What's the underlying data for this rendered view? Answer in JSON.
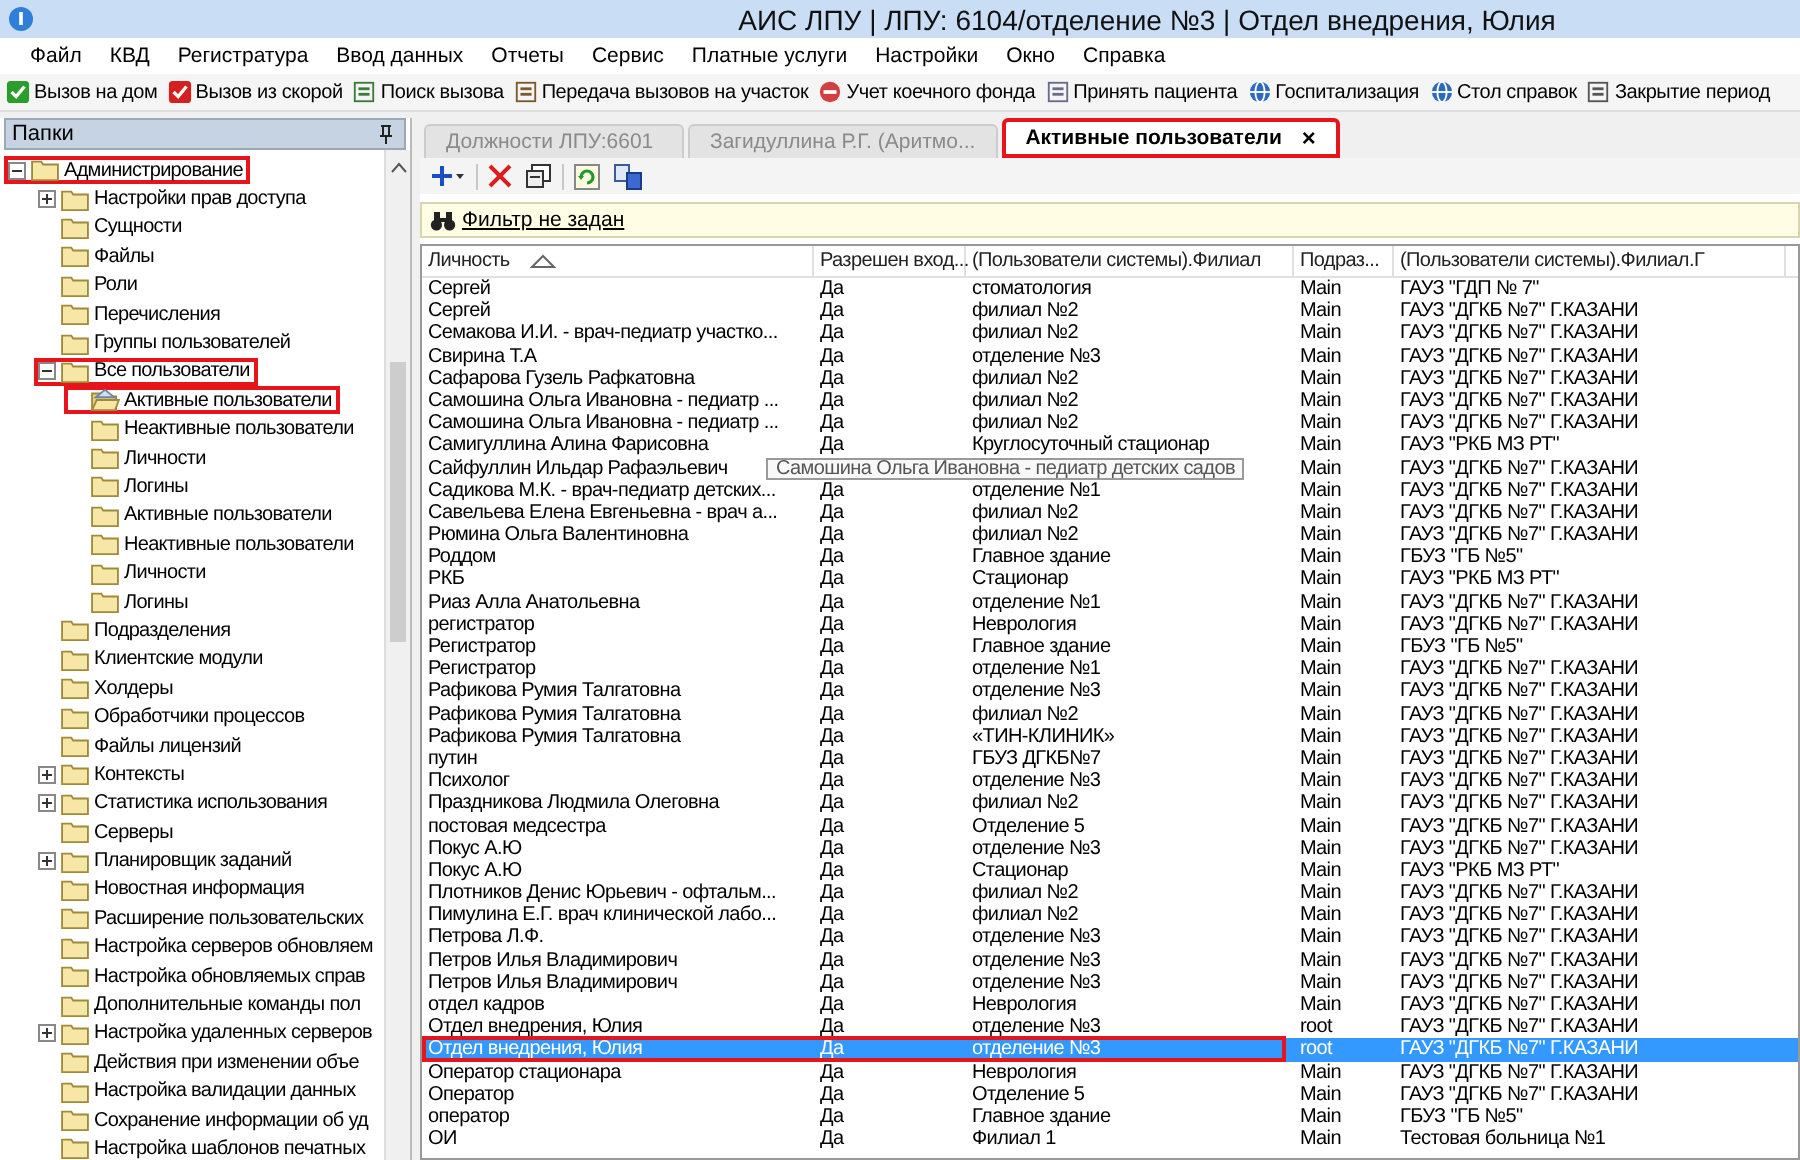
{
  "window": {
    "title": "АИС ЛПУ | ЛПУ: 6104/отделение №3 | Отдел внедрения, Юлия"
  },
  "menu": [
    "Файл",
    "КВД",
    "Регистратура",
    "Ввод данных",
    "Отчеты",
    "Сервис",
    "Платные услуги",
    "Настройки",
    "Окно",
    "Справка"
  ],
  "toolbar": [
    "Вызов на дом",
    "Вызов из скорой",
    "Поиск вызова",
    "Передача вызовов на участок",
    "Учет коечного фонда",
    "Принять пациента",
    "Госпитализация",
    "Стол справок",
    "Закрытие период"
  ],
  "folders_panel": {
    "title": "Папки",
    "tree": [
      {
        "label": "Администрирование",
        "expanded": true,
        "selected": false,
        "highlighted": true,
        "children": [
          {
            "label": "Настройки прав доступа",
            "expanded": false,
            "selected": false,
            "highlighted": false
          },
          {
            "label": "Сущности",
            "selected": false,
            "highlighted": false
          },
          {
            "label": "Файлы",
            "selected": false,
            "highlighted": false
          },
          {
            "label": "Роли",
            "selected": false,
            "highlighted": false
          },
          {
            "label": "Перечисления",
            "selected": false,
            "highlighted": false
          },
          {
            "label": "Группы пользователей",
            "selected": false,
            "highlighted": false
          },
          {
            "label": "Все пользователи",
            "expanded": true,
            "selected": false,
            "highlighted": true,
            "children": [
              {
                "label": "Активные пользователи",
                "selected": true,
                "highlighted": true
              },
              {
                "label": "Неактивные пользователи",
                "selected": false,
                "highlighted": false
              },
              {
                "label": "Личности",
                "selected": false,
                "highlighted": false
              },
              {
                "label": "Логины",
                "selected": false,
                "highlighted": false
              },
              {
                "label": "Активные пользователи",
                "selected": false,
                "highlighted": false
              },
              {
                "label": "Неактивные пользователи",
                "selected": false,
                "highlighted": false
              },
              {
                "label": "Личности",
                "selected": false,
                "highlighted": false
              },
              {
                "label": "Логины",
                "selected": false,
                "highlighted": false
              }
            ]
          },
          {
            "label": "Подразделения",
            "selected": false,
            "highlighted": false
          },
          {
            "label": "Клиентские модули",
            "selected": false,
            "highlighted": false
          },
          {
            "label": "Холдеры",
            "selected": false,
            "highlighted": false
          },
          {
            "label": "Обработчики процессов",
            "selected": false,
            "highlighted": false
          },
          {
            "label": "Файлы лицензий",
            "selected": false,
            "highlighted": false
          },
          {
            "label": "Контексты",
            "expanded": false,
            "selected": false,
            "highlighted": false
          },
          {
            "label": "Статистика использования",
            "expanded": false,
            "selected": false,
            "highlighted": false
          },
          {
            "label": "Серверы",
            "selected": false,
            "highlighted": false
          },
          {
            "label": "Планировщик заданий",
            "expanded": false,
            "selected": false,
            "highlighted": false
          },
          {
            "label": "Новостная информация",
            "selected": false,
            "highlighted": false
          },
          {
            "label": "Расширение пользовательских",
            "selected": false,
            "highlighted": false
          },
          {
            "label": "Настройка серверов обновляем",
            "selected": false,
            "highlighted": false
          },
          {
            "label": "Настройка обновляемых справ",
            "selected": false,
            "highlighted": false
          },
          {
            "label": "Дополнительные команды пол",
            "selected": false,
            "highlighted": false
          },
          {
            "label": "Настройка удаленных серверов",
            "expanded": false,
            "selected": false,
            "highlighted": false
          },
          {
            "label": "Действия при изменении объе",
            "selected": false,
            "highlighted": false
          },
          {
            "label": "Настройка валидации данных",
            "selected": false,
            "highlighted": false
          },
          {
            "label": "Сохранение информации об уд",
            "selected": false,
            "highlighted": false
          },
          {
            "label": "Настройка шаблонов печатных",
            "selected": false,
            "highlighted": false
          }
        ]
      }
    ]
  },
  "tabs": [
    {
      "label": "Должности ЛПУ:6601",
      "selected": false,
      "highlighted": false
    },
    {
      "label": "Загидуллина  Р.Г.  (Аритмо...",
      "selected": false,
      "highlighted": false
    },
    {
      "label": "Активные пользователи",
      "selected": true,
      "highlighted": true,
      "close": "×"
    }
  ],
  "filter": {
    "link": "Фильтр не задан"
  },
  "table": {
    "columns": [
      {
        "label": "Личность",
        "sorted": true
      },
      {
        "label": "Разрешен вход..."
      },
      {
        "label": "(Пользователи системы).Филиал"
      },
      {
        "label": "Подраз..."
      },
      {
        "label": "(Пользователи системы).Филиал.Г"
      }
    ],
    "rows": [
      {
        "cells": [
          "Сергей",
          "Да",
          "стоматология",
          "Main",
          "ГАУЗ \"ГДП № 7\""
        ],
        "selected": false,
        "highlighted": false
      },
      {
        "cells": [
          "Сергей",
          "Да",
          "филиал №2",
          "Main",
          "ГАУЗ \"ДГКБ №7\" Г.КАЗАНИ"
        ],
        "selected": false,
        "highlighted": false
      },
      {
        "cells": [
          "Семакова И.И. - врач-педиатр участко...",
          "Да",
          "филиал №2",
          "Main",
          "ГАУЗ \"ДГКБ №7\" Г.КАЗАНИ"
        ],
        "selected": false,
        "highlighted": false
      },
      {
        "cells": [
          "Свирина Т.А",
          "Да",
          "отделение №3",
          "Main",
          "ГАУЗ \"ДГКБ №7\" Г.КАЗАНИ"
        ],
        "selected": false,
        "highlighted": false
      },
      {
        "cells": [
          "Сафарова Гузель Рафкатовна",
          "Да",
          "филиал №2",
          "Main",
          "ГАУЗ \"ДГКБ №7\" Г.КАЗАНИ"
        ],
        "selected": false,
        "highlighted": false
      },
      {
        "cells": [
          "Самошина Ольга Ивановна - педиатр ...",
          "Да",
          "филиал №2",
          "Main",
          "ГАУЗ \"ДГКБ №7\" Г.КАЗАНИ"
        ],
        "selected": false,
        "highlighted": false
      },
      {
        "cells": [
          "Самошина Ольга Ивановна - педиатр ...",
          "Да",
          "филиал №2",
          "Main",
          "ГАУЗ \"ДГКБ №7\" Г.КАЗАНИ"
        ],
        "selected": false,
        "highlighted": false
      },
      {
        "cells": [
          "Самигуллина Алина Фарисовна",
          "Да",
          "Круглосуточный стационар",
          "Main",
          "ГАУЗ \"РКБ МЗ РТ\""
        ],
        "selected": false,
        "highlighted": false
      },
      {
        "cells": [
          "Сайфуллин Ильдар Рафаэльевич",
          null,
          null,
          "Main",
          "ГАУЗ \"ДГКБ №7\" Г.КАЗАНИ"
        ],
        "selected": false,
        "highlighted": false,
        "tooltip": "Самошина Ольга Ивановна - педиатр детских садов"
      },
      {
        "cells": [
          "Садикова М.К. - врач-педиатр детских...",
          "Да",
          "отделение №1",
          "Main",
          "ГАУЗ \"ДГКБ №7\" Г.КАЗАНИ"
        ],
        "selected": false,
        "highlighted": false
      },
      {
        "cells": [
          "Савельева Елена Евгеньевна - врач а...",
          "Да",
          "филиал №2",
          "Main",
          "ГАУЗ \"ДГКБ №7\" Г.КАЗАНИ"
        ],
        "selected": false,
        "highlighted": false
      },
      {
        "cells": [
          "Рюмина Ольга Валентиновна",
          "Да",
          "филиал №2",
          "Main",
          "ГАУЗ \"ДГКБ №7\" Г.КАЗАНИ"
        ],
        "selected": false,
        "highlighted": false
      },
      {
        "cells": [
          "Роддом",
          "Да",
          "Главное здание",
          "Main",
          "ГБУЗ \"ГБ №5\""
        ],
        "selected": false,
        "highlighted": false
      },
      {
        "cells": [
          "РКБ",
          "Да",
          "Стационар",
          "Main",
          "ГАУЗ \"РКБ МЗ РТ\""
        ],
        "selected": false,
        "highlighted": false
      },
      {
        "cells": [
          "Риаз Алла Анатольевна",
          "Да",
          "отделение №1",
          "Main",
          "ГАУЗ \"ДГКБ №7\" Г.КАЗАНИ"
        ],
        "selected": false,
        "highlighted": false
      },
      {
        "cells": [
          "регистратор",
          "Да",
          "Неврология",
          "Main",
          "ГАУЗ \"ДГКБ №7\" Г.КАЗАНИ"
        ],
        "selected": false,
        "highlighted": false
      },
      {
        "cells": [
          "Регистратор",
          "Да",
          "Главное здание",
          "Main",
          "ГБУЗ \"ГБ №5\""
        ],
        "selected": false,
        "highlighted": false
      },
      {
        "cells": [
          "Регистратор",
          "Да",
          "отделение №1",
          "Main",
          "ГАУЗ \"ДГКБ №7\" Г.КАЗАНИ"
        ],
        "selected": false,
        "highlighted": false
      },
      {
        "cells": [
          "Рафикова Румия Талгатовна",
          "Да",
          "отделение №3",
          "Main",
          "ГАУЗ \"ДГКБ №7\" Г.КАЗАНИ"
        ],
        "selected": false,
        "highlighted": false
      },
      {
        "cells": [
          "Рафикова Румия Талгатовна",
          "Да",
          "филиал №2",
          "Main",
          "ГАУЗ \"ДГКБ №7\" Г.КАЗАНИ"
        ],
        "selected": false,
        "highlighted": false
      },
      {
        "cells": [
          "Рафикова Румия Талгатовна",
          "Да",
          "«ТИН-КЛИНИК»",
          "Main",
          "ГАУЗ \"ДГКБ №7\" Г.КАЗАНИ"
        ],
        "selected": false,
        "highlighted": false
      },
      {
        "cells": [
          "путин",
          "Да",
          "ГБУЗ ДГКБ№7",
          "Main",
          "ГАУЗ \"ДГКБ №7\" Г.КАЗАНИ"
        ],
        "selected": false,
        "highlighted": false
      },
      {
        "cells": [
          "Психолог",
          "Да",
          "отделение №3",
          "Main",
          "ГАУЗ \"ДГКБ №7\" Г.КАЗАНИ"
        ],
        "selected": false,
        "highlighted": false
      },
      {
        "cells": [
          "Праздникова Людмила Олеговна",
          "Да",
          "филиал №2",
          "Main",
          "ГАУЗ \"ДГКБ №7\" Г.КАЗАНИ"
        ],
        "selected": false,
        "highlighted": false
      },
      {
        "cells": [
          "постовая медсестра",
          "Да",
          "Отделение 5",
          "Main",
          "ГАУЗ \"ДГКБ №7\" Г.КАЗАНИ"
        ],
        "selected": false,
        "highlighted": false
      },
      {
        "cells": [
          "Покус А.Ю",
          "Да",
          "отделение №3",
          "Main",
          "ГАУЗ \"ДГКБ №7\" Г.КАЗАНИ"
        ],
        "selected": false,
        "highlighted": false
      },
      {
        "cells": [
          "Покус А.Ю",
          "Да",
          "Стационар",
          "Main",
          "ГАУЗ \"РКБ МЗ РТ\""
        ],
        "selected": false,
        "highlighted": false
      },
      {
        "cells": [
          "Плотников Денис Юрьевич - офтальм...",
          "Да",
          "филиал №2",
          "Main",
          "ГАУЗ \"ДГКБ №7\" Г.КАЗАНИ"
        ],
        "selected": false,
        "highlighted": false
      },
      {
        "cells": [
          "Пимулина Е.Г. врач клинической лабо...",
          "Да",
          "филиал №2",
          "Main",
          "ГАУЗ \"ДГКБ №7\" Г.КАЗАНИ"
        ],
        "selected": false,
        "highlighted": false
      },
      {
        "cells": [
          "Петрова Л.Ф.",
          "Да",
          "отделение №3",
          "Main",
          "ГАУЗ \"ДГКБ №7\" Г.КАЗАНИ"
        ],
        "selected": false,
        "highlighted": false
      },
      {
        "cells": [
          "Петров Илья Владимирович",
          "Да",
          "отделение №3",
          "Main",
          "ГАУЗ \"ДГКБ №7\" Г.КАЗАНИ"
        ],
        "selected": false,
        "highlighted": false
      },
      {
        "cells": [
          "Петров Илья Владимирович",
          "Да",
          "отделение №3",
          "Main",
          "ГАУЗ \"ДГКБ №7\" Г.КАЗАНИ"
        ],
        "selected": false,
        "highlighted": false
      },
      {
        "cells": [
          "отдел кадров",
          "Да",
          "Неврология",
          "Main",
          "ГАУЗ \"ДГКБ №7\" Г.КАЗАНИ"
        ],
        "selected": false,
        "highlighted": false
      },
      {
        "cells": [
          "Отдел внедрения, Юлия",
          "Да",
          "отделение №3",
          "root",
          "ГАУЗ \"ДГКБ №7\" Г.КАЗАНИ"
        ],
        "selected": false,
        "highlighted": false
      },
      {
        "cells": [
          "Отдел внедрения, Юлия",
          "Да",
          "отделение №3",
          "root",
          "ГАУЗ \"ДГКБ №7\" Г.КАЗАНИ"
        ],
        "selected": true,
        "highlighted": true
      },
      {
        "cells": [
          "Оператор стационара",
          "Да",
          "Неврология",
          "Main",
          "ГАУЗ \"ДГКБ №7\" Г.КАЗАНИ"
        ],
        "selected": false,
        "highlighted": false
      },
      {
        "cells": [
          "Оператор",
          "Да",
          "Отделение 5",
          "Main",
          "ГАУЗ \"ДГКБ №7\" Г.КАЗАНИ"
        ],
        "selected": false,
        "highlighted": false
      },
      {
        "cells": [
          "оператор",
          "Да",
          "Главное здание",
          "Main",
          "ГБУЗ \"ГБ №5\""
        ],
        "selected": false,
        "highlighted": false
      },
      {
        "cells": [
          "ОИ",
          "Да",
          "Филиал 1",
          "Main",
          "Тестовая больница №1"
        ],
        "selected": false,
        "highlighted": false
      }
    ]
  }
}
